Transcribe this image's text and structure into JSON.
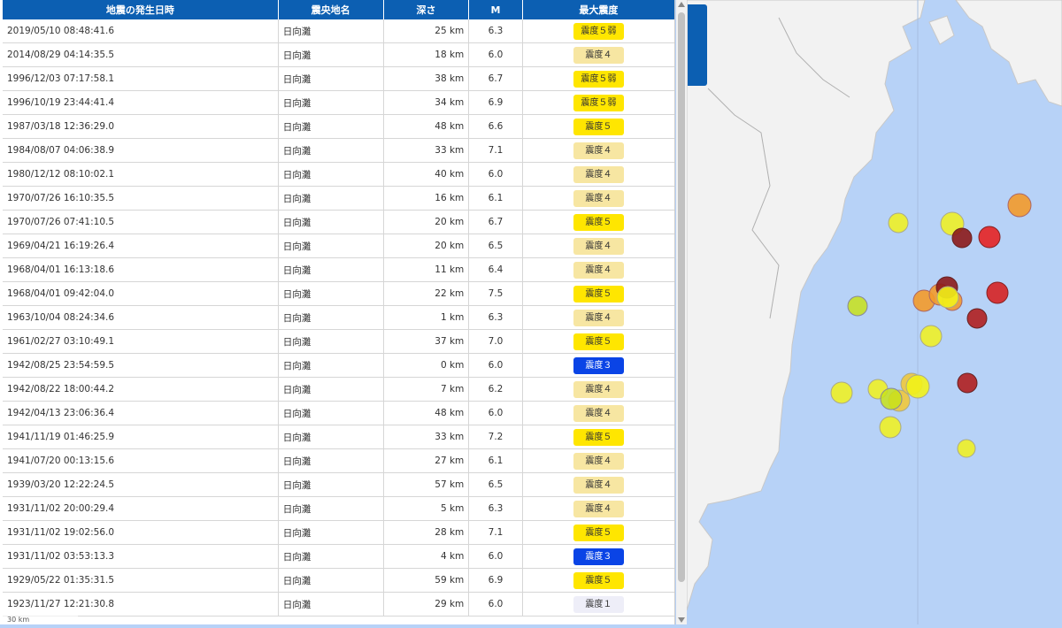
{
  "table": {
    "headers": [
      "地震の発生日時",
      "震央地名",
      "深さ",
      "M",
      "最大震度"
    ],
    "rows": [
      {
        "date": "2019/05/10 08:48:41.6",
        "place": "日向灘",
        "depth": "25 km",
        "mag": "6.3",
        "intensity": "震度５弱",
        "level": "5-"
      },
      {
        "date": "2014/08/29 04:14:35.5",
        "place": "日向灘",
        "depth": "18 km",
        "mag": "6.0",
        "intensity": "震度４",
        "level": "4"
      },
      {
        "date": "1996/12/03 07:17:58.1",
        "place": "日向灘",
        "depth": "38 km",
        "mag": "6.7",
        "intensity": "震度５弱",
        "level": "5-"
      },
      {
        "date": "1996/10/19 23:44:41.4",
        "place": "日向灘",
        "depth": "34 km",
        "mag": "6.9",
        "intensity": "震度５弱",
        "level": "5-"
      },
      {
        "date": "1987/03/18 12:36:29.0",
        "place": "日向灘",
        "depth": "48 km",
        "mag": "6.6",
        "intensity": "震度５",
        "level": "5"
      },
      {
        "date": "1984/08/07 04:06:38.9",
        "place": "日向灘",
        "depth": "33 km",
        "mag": "7.1",
        "intensity": "震度４",
        "level": "4"
      },
      {
        "date": "1980/12/12 08:10:02.1",
        "place": "日向灘",
        "depth": "40 km",
        "mag": "6.0",
        "intensity": "震度４",
        "level": "4"
      },
      {
        "date": "1970/07/26 16:10:35.5",
        "place": "日向灘",
        "depth": "16 km",
        "mag": "6.1",
        "intensity": "震度４",
        "level": "4"
      },
      {
        "date": "1970/07/26 07:41:10.5",
        "place": "日向灘",
        "depth": "20 km",
        "mag": "6.7",
        "intensity": "震度５",
        "level": "5"
      },
      {
        "date": "1969/04/21 16:19:26.4",
        "place": "日向灘",
        "depth": "20 km",
        "mag": "6.5",
        "intensity": "震度４",
        "level": "4"
      },
      {
        "date": "1968/04/01 16:13:18.6",
        "place": "日向灘",
        "depth": "11 km",
        "mag": "6.4",
        "intensity": "震度４",
        "level": "4"
      },
      {
        "date": "1968/04/01 09:42:04.0",
        "place": "日向灘",
        "depth": "22 km",
        "mag": "7.5",
        "intensity": "震度５",
        "level": "5"
      },
      {
        "date": "1963/10/04 08:24:34.6",
        "place": "日向灘",
        "depth": "1 km",
        "mag": "6.3",
        "intensity": "震度４",
        "level": "4"
      },
      {
        "date": "1961/02/27 03:10:49.1",
        "place": "日向灘",
        "depth": "37 km",
        "mag": "7.0",
        "intensity": "震度５",
        "level": "5"
      },
      {
        "date": "1942/08/25 23:54:59.5",
        "place": "日向灘",
        "depth": "0 km",
        "mag": "6.0",
        "intensity": "震度３",
        "level": "3"
      },
      {
        "date": "1942/08/22 18:00:44.2",
        "place": "日向灘",
        "depth": "7 km",
        "mag": "6.2",
        "intensity": "震度４",
        "level": "4"
      },
      {
        "date": "1942/04/13 23:06:36.4",
        "place": "日向灘",
        "depth": "48 km",
        "mag": "6.0",
        "intensity": "震度４",
        "level": "4"
      },
      {
        "date": "1941/11/19 01:46:25.9",
        "place": "日向灘",
        "depth": "33 km",
        "mag": "7.2",
        "intensity": "震度５",
        "level": "5"
      },
      {
        "date": "1941/07/20 00:13:15.6",
        "place": "日向灘",
        "depth": "27 km",
        "mag": "6.1",
        "intensity": "震度４",
        "level": "4"
      },
      {
        "date": "1939/03/20 12:22:24.5",
        "place": "日向灘",
        "depth": "57 km",
        "mag": "6.5",
        "intensity": "震度４",
        "level": "4"
      },
      {
        "date": "1931/11/02 20:00:29.4",
        "place": "日向灘",
        "depth": "5 km",
        "mag": "6.3",
        "intensity": "震度４",
        "level": "4"
      },
      {
        "date": "1931/11/02 19:02:56.0",
        "place": "日向灘",
        "depth": "28 km",
        "mag": "7.1",
        "intensity": "震度５",
        "level": "5"
      },
      {
        "date": "1931/11/02 03:53:13.3",
        "place": "日向灘",
        "depth": "4 km",
        "mag": "6.0",
        "intensity": "震度３",
        "level": "3"
      },
      {
        "date": "1929/05/22 01:35:31.5",
        "place": "日向灘",
        "depth": "59 km",
        "mag": "6.9",
        "intensity": "震度５",
        "level": "5"
      },
      {
        "date": "1923/11/27 12:21:30.8",
        "place": "日向灘",
        "depth": "29 km",
        "mag": "6.0",
        "intensity": "震度１",
        "level": "1"
      }
    ]
  },
  "intensity_colors": {
    "5-": {
      "bg": "#ffe600",
      "fg": "#333333"
    },
    "5": {
      "bg": "#ffe600",
      "fg": "#333333"
    },
    "4": {
      "bg": "#f7e6a2",
      "fg": "#333333"
    },
    "3": {
      "bg": "#0a44e6",
      "fg": "#ffffff"
    },
    "1": {
      "bg": "#eeeef8",
      "fg": "#333333"
    }
  },
  "map": {
    "sea_color": "#b7d2f7",
    "land_color": "#f2f2f2",
    "scale_label": "30 km"
  }
}
